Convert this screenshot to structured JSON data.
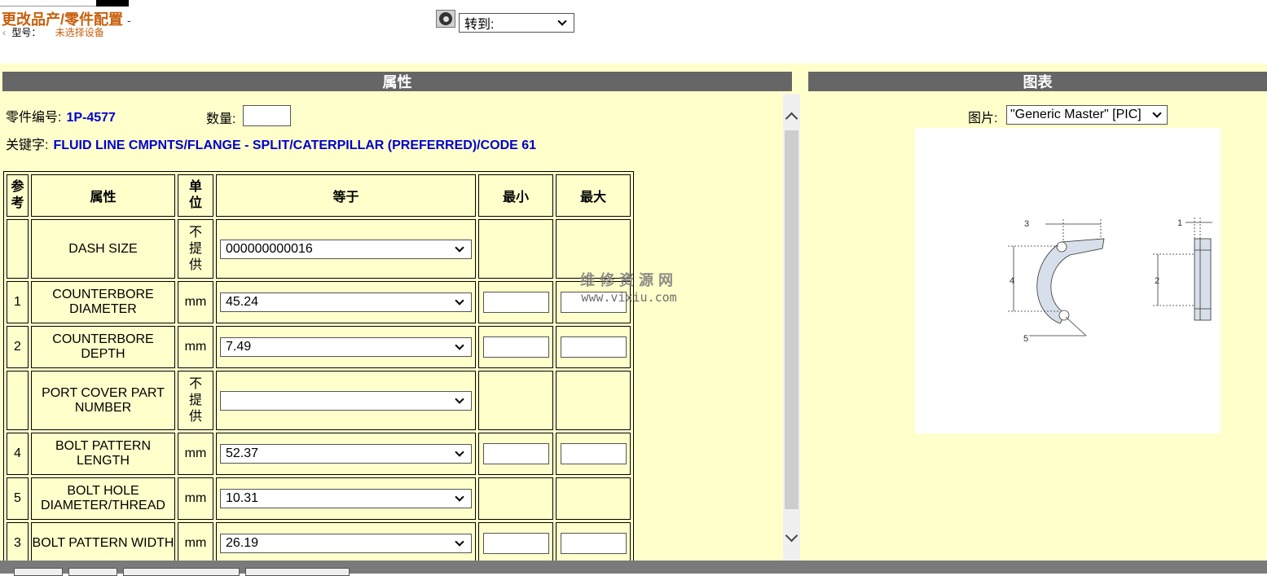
{
  "header": {
    "title": "更改品产/零件配置",
    "title_suffix": "-",
    "back_glyph": "‹",
    "model_label": "型号：",
    "model_value": "未选择设备",
    "goto_label": "转到:"
  },
  "properties_panel": {
    "title": "属性",
    "part_number_label": "零件编号:",
    "part_number": "1P-4577",
    "quantity_label": "数量:",
    "quantity_value": "",
    "keyword_label": "关键字:",
    "keyword": "FLUID LINE CMPNTS/FLANGE - SPLIT/CATERPILLAR (PREFERRED)/CODE 61"
  },
  "table": {
    "headers": {
      "ref": [
        "参",
        "考"
      ],
      "attribute": "属性",
      "unit": [
        "单",
        "位"
      ],
      "equals": "等于",
      "min": "最小",
      "max": "最大"
    },
    "rows": [
      {
        "ref": "",
        "attribute": "DASH SIZE",
        "unit": [
          "不",
          "提",
          "供"
        ],
        "equals": "000000000016",
        "has_min_max": false
      },
      {
        "ref": "1",
        "attribute": "COUNTERBORE DIAMETER",
        "unit": [
          "mm"
        ],
        "equals": "45.24",
        "has_min_max": true
      },
      {
        "ref": "2",
        "attribute": "COUNTERBORE DEPTH",
        "unit": [
          "mm"
        ],
        "equals": "7.49",
        "has_min_max": true
      },
      {
        "ref": "",
        "attribute": "PORT COVER PART NUMBER",
        "unit": [
          "不",
          "提",
          "供"
        ],
        "equals": "",
        "has_min_max": false
      },
      {
        "ref": "4",
        "attribute": "BOLT PATTERN LENGTH",
        "unit": [
          "mm"
        ],
        "equals": "52.37",
        "has_min_max": true
      },
      {
        "ref": "5",
        "attribute": "BOLT HOLE DIAMETER/THREAD",
        "unit": [
          "mm"
        ],
        "equals": "10.31",
        "has_min_max": false
      },
      {
        "ref": "3",
        "attribute": "BOLT PATTERN WIDTH",
        "unit": [
          "mm"
        ],
        "equals": "26.19",
        "has_min_max": true
      }
    ]
  },
  "chart_panel": {
    "title": "图表",
    "picture_label": "图片:",
    "picture_value": "\"Generic Master\" [PIC]",
    "diagram_labels": {
      "l3": "3",
      "l1": "1",
      "l4": "4",
      "l2": "2",
      "l5": "5"
    }
  },
  "watermark": {
    "line1": "维修资源网",
    "line2": "www.vixiu.com"
  },
  "colors": {
    "panel_bg": "#ffffcc",
    "header_bar": "#666666",
    "title_orange": "#c8600c",
    "link_blue": "#0000cc"
  }
}
